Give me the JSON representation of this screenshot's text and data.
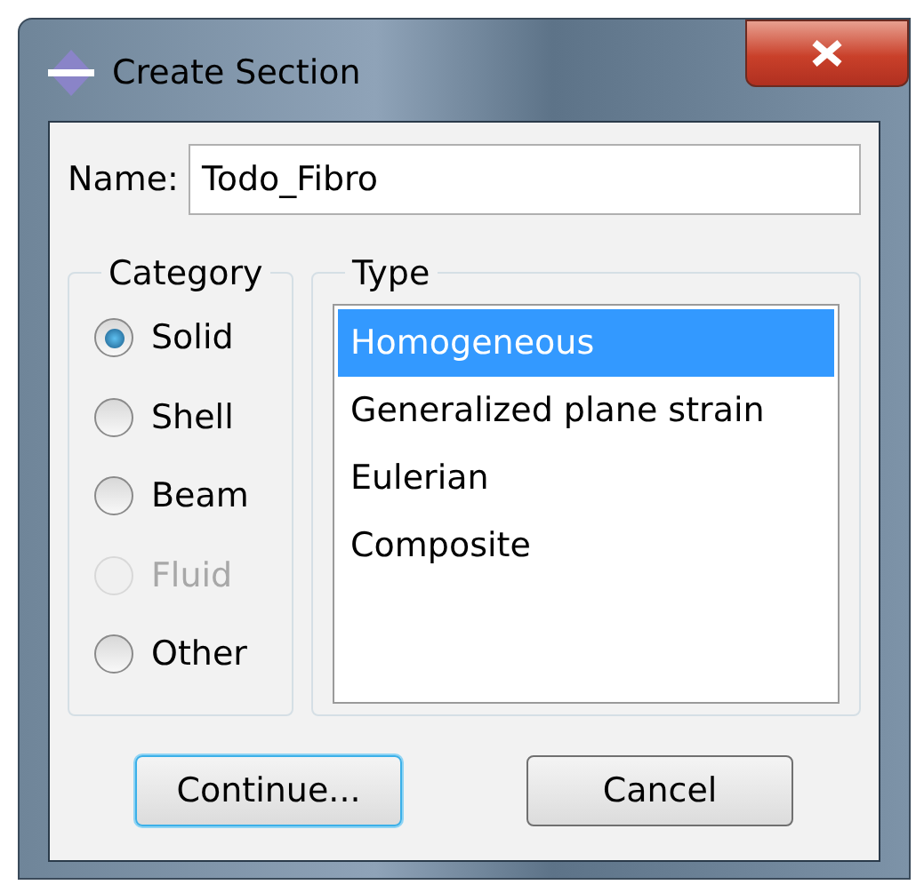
{
  "window": {
    "title": "Create Section"
  },
  "name_field": {
    "label": "Name:",
    "value": "Todo_Fibro"
  },
  "category": {
    "title": "Category",
    "options": [
      {
        "label": "Solid",
        "selected": true,
        "disabled": false
      },
      {
        "label": "Shell",
        "selected": false,
        "disabled": false
      },
      {
        "label": "Beam",
        "selected": false,
        "disabled": false
      },
      {
        "label": "Fluid",
        "selected": false,
        "disabled": true
      },
      {
        "label": "Other",
        "selected": false,
        "disabled": false
      }
    ]
  },
  "type": {
    "title": "Type",
    "items": [
      {
        "label": "Homogeneous",
        "selected": true
      },
      {
        "label": "Generalized plane strain",
        "selected": false
      },
      {
        "label": "Eulerian",
        "selected": false
      },
      {
        "label": "Composite",
        "selected": false
      }
    ]
  },
  "buttons": [
    {
      "label": "Continue...",
      "focused": true
    },
    {
      "label": "Cancel",
      "focused": false
    }
  ]
}
